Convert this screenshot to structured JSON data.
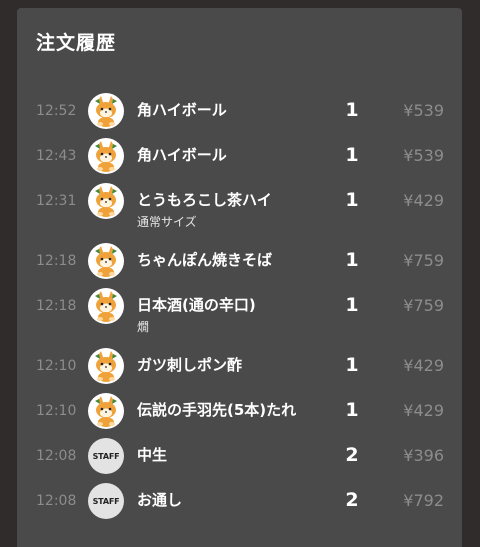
{
  "page": {
    "title": "注文履歴"
  },
  "orders": [
    {
      "time": "12:52",
      "name": "角ハイボール",
      "note": "",
      "qty": "1",
      "price": "¥539",
      "avatar": "fox-mascot-icon"
    },
    {
      "time": "12:43",
      "name": "角ハイボール",
      "note": "",
      "qty": "1",
      "price": "¥539",
      "avatar": "fox-mascot-icon"
    },
    {
      "time": "12:31",
      "name": "とうもろこし茶ハイ",
      "note": "通常サイズ",
      "qty": "1",
      "price": "¥429",
      "avatar": "fox-mascot-icon"
    },
    {
      "time": "12:18",
      "name": "ちゃんぽん焼きそば",
      "note": "",
      "qty": "1",
      "price": "¥759",
      "avatar": "fox-mascot-icon"
    },
    {
      "time": "12:18",
      "name": "日本酒(通の辛口)",
      "note": "燗",
      "qty": "1",
      "price": "¥759",
      "avatar": "fox-mascot-icon"
    },
    {
      "time": "12:10",
      "name": "ガツ刺しポン酢",
      "note": "",
      "qty": "1",
      "price": "¥429",
      "avatar": "fox-mascot-icon"
    },
    {
      "time": "12:10",
      "name": "伝説の手羽先(5本)たれ",
      "note": "",
      "qty": "1",
      "price": "¥429",
      "avatar": "fox-mascot-icon"
    },
    {
      "time": "12:08",
      "name": "中生",
      "note": "",
      "qty": "2",
      "price": "¥396",
      "avatar": "STAFF"
    },
    {
      "time": "12:08",
      "name": "お通し",
      "note": "",
      "qty": "2",
      "price": "¥792",
      "avatar": "STAFF"
    }
  ],
  "colors": {
    "background": "#302c2b",
    "panel": "#4b4a4a",
    "muted_text": "#8c8c8c",
    "fox_orange": "#f0a23a"
  }
}
